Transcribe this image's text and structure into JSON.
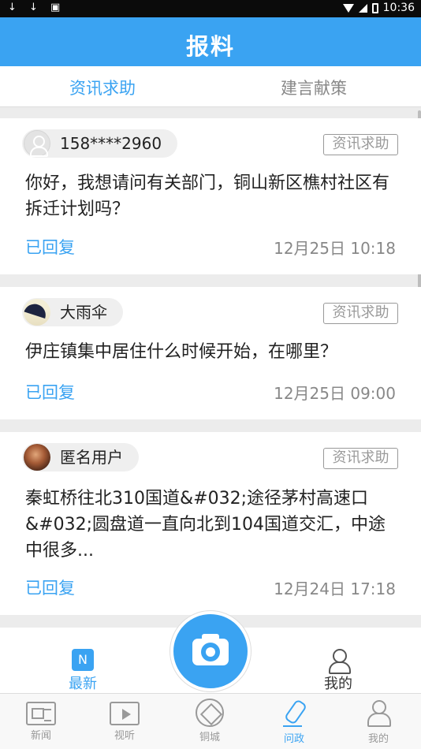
{
  "status_bar": {
    "icons_left": "↓ ↓ ▣",
    "time": "10:36"
  },
  "header": {
    "title": "报料"
  },
  "tabs": [
    {
      "label": "资讯求助",
      "active": true
    },
    {
      "label": "建言献策",
      "active": false
    }
  ],
  "posts": [
    {
      "user": "158****2960",
      "avatar": "default-avatar-icon",
      "tag": "资讯求助",
      "content": "你好，我想请问有关部门，铜山新区樵村社区有拆迁计划吗？",
      "status": "已回复",
      "time": "12月25日 10:18"
    },
    {
      "user": "大雨伞",
      "avatar": "umbrella-avatar",
      "tag": "资讯求助",
      "content": "伊庄镇集中居住什么时候开始，在哪里？",
      "status": "已回复",
      "time": "12月25日 09:00"
    },
    {
      "user": "匿名用户",
      "avatar": "photo-avatar",
      "tag": "资讯求助",
      "content": "秦虹桥往北310国道&#032;途径茅村高速口&#032;圆盘道一直向北到104国道交汇，中途中很多...",
      "status": "已回复",
      "time": "12月24日 17:18"
    }
  ],
  "floating_tabs": {
    "latest_label": "最新",
    "latest_badge": "N",
    "mine_label": "我的"
  },
  "bottom_nav": [
    {
      "label": "新闻",
      "icon": "newspaper-icon",
      "active": false
    },
    {
      "label": "视听",
      "icon": "video-play-icon",
      "active": false
    },
    {
      "label": "铜城",
      "icon": "city-logo-icon",
      "active": false
    },
    {
      "label": "问政",
      "icon": "microphone-pen-icon",
      "active": true
    },
    {
      "label": "我的",
      "icon": "person-icon",
      "active": false
    }
  ],
  "colors": {
    "accent": "#3aa3f2",
    "tag_gray": "#999999",
    "background": "#ececec"
  }
}
